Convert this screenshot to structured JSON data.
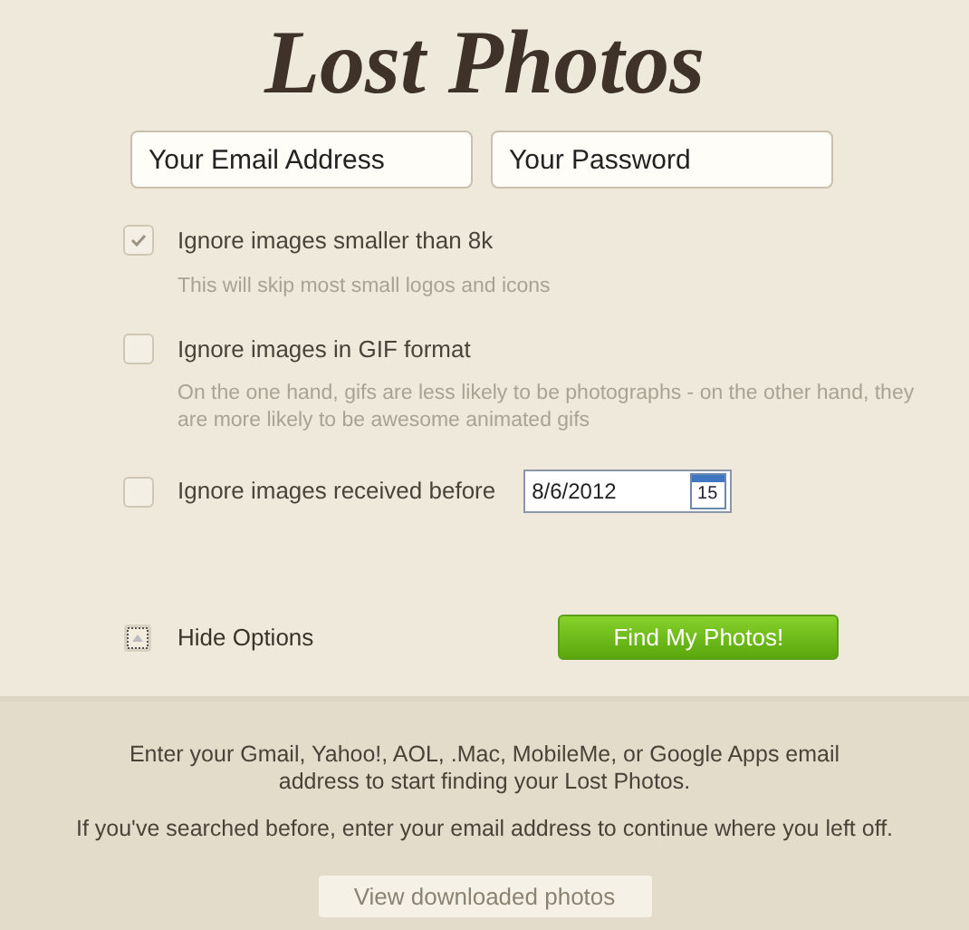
{
  "logo": "Lost Photos",
  "fields": [
    {
      "placeholder": "Your Email Address"
    },
    {
      "placeholder": "Your Password"
    }
  ],
  "options": [
    {
      "kind": "hint",
      "label": "Ignore images smaller than 8k",
      "checked": true,
      "hint": "This will skip most small logos and icons"
    },
    {
      "kind": "hint",
      "label": "Ignore images in GIF format",
      "checked": false,
      "hint": "On the one hand, gifs are less likely to be photographs - on the other hand, they are more likely to be awesome animated gifs"
    },
    {
      "kind": "date",
      "label": "Ignore images received before",
      "checked": false,
      "date": "8/6/2012",
      "calendar_day": "15"
    }
  ],
  "hide_options": "Hide Options",
  "submit": "Find My Photos!",
  "info": [
    "Enter your Gmail, Yahoo!, AOL, .Mac, MobileMe, or Google Apps email address to start finding your Lost Photos.",
    "If you've searched before, enter your email address to continue where you left off."
  ],
  "view_button": "View downloaded photos"
}
